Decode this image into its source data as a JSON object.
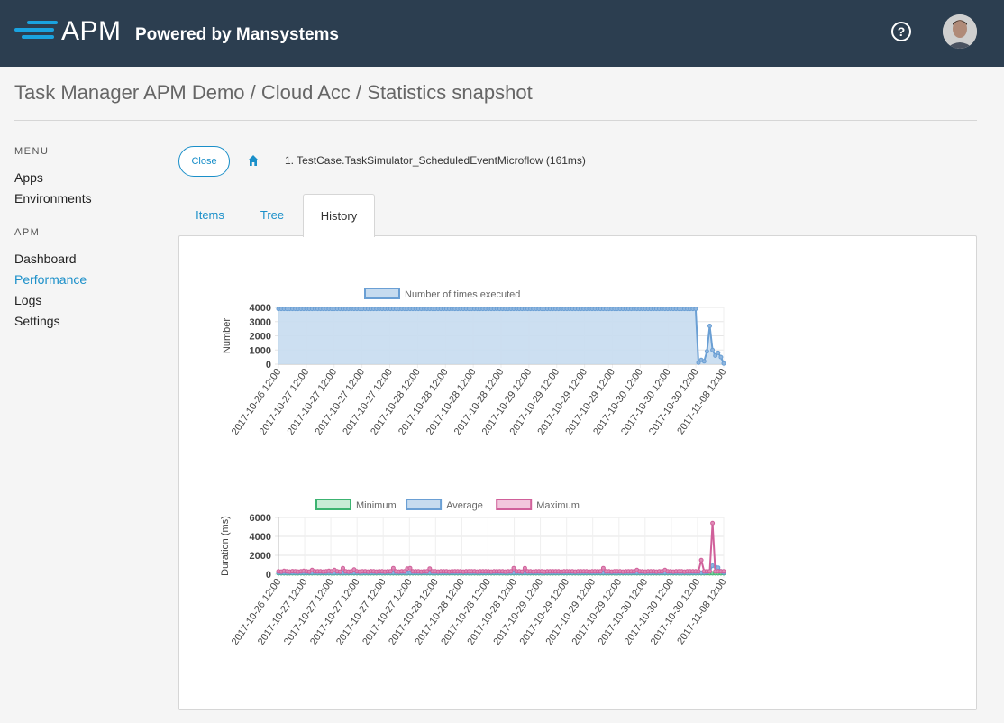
{
  "header": {
    "logo_text": "APM",
    "logo_sub": "Powered by Mansystems",
    "help_label": "?"
  },
  "page_title": "Task Manager APM Demo / Cloud Acc / Statistics snapshot",
  "sidebar": {
    "menu_heading": "MENU",
    "menu_items": [
      {
        "label": "Apps"
      },
      {
        "label": "Environments"
      }
    ],
    "apm_heading": "APM",
    "apm_items": [
      {
        "label": "Dashboard"
      },
      {
        "label": "Performance",
        "active": true
      },
      {
        "label": "Logs"
      },
      {
        "label": "Settings"
      }
    ]
  },
  "toolbar": {
    "close_label": "Close",
    "breadcrumb": "1. TestCase.TaskSimulator_ScheduledEventMicroflow (161ms)"
  },
  "tabs": [
    {
      "label": "Items"
    },
    {
      "label": "Tree"
    },
    {
      "label": "History",
      "active": true
    }
  ],
  "colors": {
    "accent": "#1a8fc9",
    "header_bg": "#2c3e50",
    "count_line": "#6a9fd4",
    "count_fill": "#c6dbef",
    "min_line": "#3cb371",
    "avg_line": "#6a9fd4",
    "max_line": "#d0609a"
  },
  "chart_data": [
    {
      "type": "area",
      "ylabel": "Number",
      "ylim": [
        0,
        4000
      ],
      "yticks": [
        0,
        1000,
        2000,
        3000,
        4000
      ],
      "xtick_labels": [
        "2017-10-26 12:00",
        "2017-10-27 12:00",
        "2017-10-27 12:00",
        "2017-10-27 12:00",
        "2017-10-27 12:00",
        "2017-10-28 12:00",
        "2017-10-28 12:00",
        "2017-10-28 12:00",
        "2017-10-28 12:00",
        "2017-10-29 12:00",
        "2017-10-29 12:00",
        "2017-10-29 12:00",
        "2017-10-29 12:00",
        "2017-10-30 12:00",
        "2017-10-30 12:00",
        "2017-10-30 12:00",
        "2017-11-08 12:00"
      ],
      "legend_position": "top",
      "series": [
        {
          "name": "Number of times executed",
          "values": [
            3900,
            3900,
            3900,
            3900,
            3900,
            3900,
            3900,
            3900,
            3900,
            3900,
            3900,
            3900,
            3900,
            3900,
            3900,
            3900,
            3900,
            3900,
            3900,
            3900,
            3900,
            3900,
            3900,
            3900,
            3900,
            3900,
            3900,
            3900,
            3900,
            3900,
            3900,
            3900,
            3900,
            3900,
            3900,
            3900,
            3900,
            3900,
            3900,
            3900,
            3900,
            3900,
            3900,
            3900,
            3900,
            3900,
            3900,
            3900,
            3900,
            3900,
            3900,
            3900,
            3900,
            3900,
            3900,
            3900,
            3900,
            3900,
            3900,
            3900,
            3900,
            3900,
            3900,
            3900,
            3900,
            3900,
            3900,
            3900,
            3900,
            3900,
            3900,
            3900,
            3900,
            3900,
            3900,
            3900,
            3900,
            3900,
            3900,
            3900,
            3900,
            3900,
            3900,
            3900,
            3900,
            3900,
            3900,
            3900,
            3900,
            3900,
            3900,
            3900,
            3900,
            3900,
            3900,
            3900,
            3900,
            3900,
            3900,
            3900,
            3900,
            3900,
            3900,
            3900,
            3900,
            3900,
            3900,
            3900,
            3900,
            3900,
            3900,
            3900,
            3900,
            3900,
            3900,
            3900,
            3900,
            3900,
            3900,
            3900,
            3900,
            3900,
            3900,
            3900,
            3900,
            3900,
            3900,
            3900,
            3900,
            3900,
            3900,
            3900,
            3900,
            3900,
            3900,
            3900,
            3900,
            3900,
            3900,
            3900,
            3900,
            3900,
            3900,
            3900,
            3900,
            3900,
            3900,
            3900,
            3900,
            3900,
            100,
            300,
            200,
            900,
            2700,
            1000,
            600,
            800,
            500,
            50
          ]
        }
      ]
    },
    {
      "type": "line",
      "ylabel": "Duration (ms)",
      "ylim": [
        0,
        6000
      ],
      "yticks": [
        0,
        2000,
        4000,
        6000
      ],
      "xtick_labels": [
        "2017-10-26 12:00",
        "2017-10-27 12:00",
        "2017-10-27 12:00",
        "2017-10-27 12:00",
        "2017-10-27 12:00",
        "2017-10-27 12:00",
        "2017-10-28 12:00",
        "2017-10-28 12:00",
        "2017-10-28 12:00",
        "2017-10-28 12:00",
        "2017-10-29 12:00",
        "2017-10-29 12:00",
        "2017-10-29 12:00",
        "2017-10-29 12:00",
        "2017-10-30 12:00",
        "2017-10-30 12:00",
        "2017-10-30 12:00",
        "2017-11-08 12:00"
      ],
      "legend_position": "top",
      "series": [
        {
          "name": "Minimum",
          "values": [
            100,
            100,
            100,
            100,
            100,
            100,
            100,
            100,
            100,
            100,
            100,
            100,
            100,
            100,
            100,
            100,
            100,
            100,
            100,
            100,
            100,
            100,
            100,
            100,
            100,
            100,
            100,
            100,
            100,
            100,
            100,
            100,
            100,
            100,
            100,
            100,
            100,
            100,
            100,
            100,
            100,
            100,
            100,
            100,
            100,
            100,
            100,
            100,
            100,
            100,
            100,
            100,
            100,
            100,
            100,
            100,
            100,
            100,
            100,
            100,
            100,
            100,
            100,
            100,
            100,
            100,
            100,
            100,
            100,
            100,
            100,
            100,
            100,
            100,
            100,
            100,
            100,
            100,
            100,
            100,
            100,
            100,
            100,
            100,
            100,
            100,
            100,
            100,
            100,
            100,
            100,
            100,
            100,
            100,
            100,
            100,
            100,
            100,
            100,
            100,
            100,
            100,
            100,
            100,
            100,
            100,
            100,
            100,
            100,
            100,
            100,
            100,
            100,
            100,
            100,
            100,
            100,
            100,
            100,
            100,
            100,
            100,
            100,
            100,
            100,
            100,
            100,
            100,
            100,
            100,
            100,
            100,
            100,
            100,
            100,
            100,
            100,
            100,
            100,
            100,
            100,
            100,
            100,
            100,
            100,
            100,
            100,
            100,
            100,
            100,
            100,
            100,
            100,
            100,
            100,
            100,
            100,
            100,
            100,
            100
          ]
        },
        {
          "name": "Average",
          "values": [
            160,
            160,
            160,
            160,
            160,
            160,
            160,
            160,
            160,
            160,
            160,
            160,
            160,
            160,
            160,
            160,
            160,
            160,
            160,
            160,
            160,
            160,
            160,
            160,
            160,
            160,
            160,
            160,
            160,
            160,
            160,
            160,
            160,
            160,
            160,
            160,
            160,
            160,
            160,
            160,
            160,
            160,
            160,
            160,
            160,
            160,
            160,
            160,
            160,
            160,
            160,
            160,
            160,
            160,
            160,
            160,
            160,
            160,
            160,
            160,
            160,
            160,
            160,
            160,
            160,
            160,
            160,
            160,
            160,
            160,
            160,
            160,
            160,
            160,
            160,
            160,
            160,
            160,
            160,
            160,
            160,
            160,
            160,
            160,
            160,
            160,
            160,
            160,
            160,
            160,
            160,
            160,
            160,
            160,
            160,
            160,
            160,
            160,
            160,
            160,
            160,
            160,
            160,
            160,
            160,
            160,
            160,
            160,
            160,
            160,
            160,
            160,
            160,
            160,
            160,
            160,
            160,
            160,
            160,
            160,
            160,
            160,
            160,
            160,
            160,
            160,
            160,
            160,
            160,
            160,
            160,
            160,
            160,
            160,
            160,
            160,
            160,
            160,
            160,
            160,
            160,
            160,
            160,
            160,
            160,
            160,
            160,
            160,
            160,
            160,
            160,
            160,
            160,
            200,
            300,
            900,
            800,
            700,
            300,
            160
          ]
        },
        {
          "name": "Maximum",
          "values": [
            300,
            280,
            350,
            300,
            280,
            320,
            300,
            280,
            300,
            350,
            300,
            280,
            450,
            300,
            300,
            300,
            280,
            300,
            350,
            300,
            450,
            300,
            280,
            650,
            300,
            280,
            300,
            500,
            300,
            280,
            300,
            300,
            280,
            320,
            300,
            280,
            300,
            300,
            280,
            300,
            300,
            650,
            300,
            280,
            300,
            300,
            600,
            650,
            300,
            300,
            300,
            280,
            300,
            300,
            600,
            300,
            300,
            280,
            300,
            300,
            300,
            280,
            300,
            300,
            300,
            300,
            280,
            300,
            300,
            300,
            300,
            280,
            300,
            300,
            300,
            300,
            280,
            300,
            300,
            300,
            300,
            280,
            300,
            300,
            650,
            300,
            300,
            280,
            650,
            300,
            300,
            280,
            300,
            300,
            300,
            280,
            300,
            300,
            300,
            300,
            300,
            280,
            300,
            300,
            300,
            300,
            280,
            300,
            300,
            300,
            300,
            280,
            300,
            300,
            300,
            300,
            650,
            300,
            300,
            280,
            300,
            300,
            300,
            280,
            300,
            300,
            300,
            300,
            450,
            300,
            300,
            280,
            300,
            300,
            300,
            280,
            300,
            300,
            450,
            300,
            300,
            280,
            300,
            300,
            300,
            280,
            300,
            300,
            300,
            300,
            300,
            1500,
            300,
            300,
            300,
            5400,
            300,
            300,
            300,
            300
          ]
        }
      ]
    }
  ]
}
